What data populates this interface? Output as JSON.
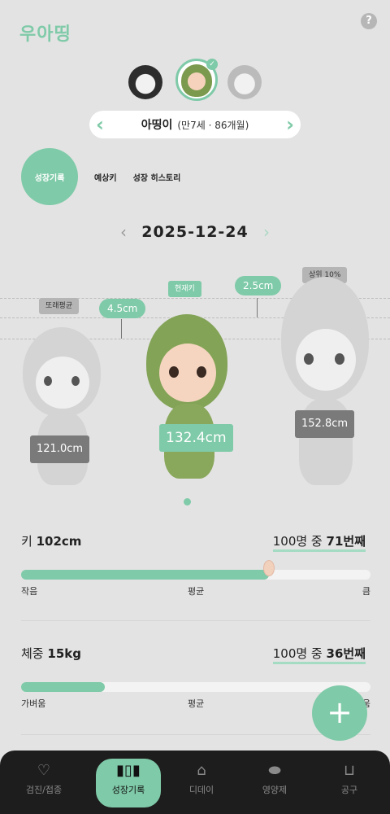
{
  "app": {
    "logo": "우아띵",
    "help_icon": "?"
  },
  "profile": {
    "name": "아띵이",
    "age": "(만7세 · 86개월)"
  },
  "tabs": {
    "growth_record": "성장기록",
    "predicted_height": "예상키",
    "growth_history": "성장 히스토리"
  },
  "date": "2025-12-24",
  "figures": {
    "peer_avg_label": "또래평균",
    "peer_avg_value": "121.0cm",
    "current_label": "현재키",
    "current_value": "132.4cm",
    "top_label": "상위 10%",
    "top_value": "152.8cm",
    "diff_peer": "4.5cm",
    "diff_top": "2.5cm"
  },
  "height": {
    "label": "키",
    "value": "102cm",
    "rank_prefix": "100명 중",
    "rank": "71번째",
    "percent": 71,
    "scale_low": "작음",
    "scale_mid": "평균",
    "scale_high": "큼"
  },
  "weight": {
    "label": "체중",
    "value": "15kg",
    "rank_prefix": "100명 중",
    "rank": "36번째",
    "percent": 24,
    "scale_low": "가벼움",
    "scale_mid": "평균",
    "scale_high": "무거움"
  },
  "nav": [
    {
      "label": "검진/접종",
      "icon": "heartbeat-icon"
    },
    {
      "label": "성장기록",
      "icon": "bar-chart-icon"
    },
    {
      "label": "디데이",
      "icon": "house-icon"
    },
    {
      "label": "영양제",
      "icon": "pill-icon"
    },
    {
      "label": "공구",
      "icon": "shopping-bag-icon"
    }
  ],
  "colors": {
    "accent": "#7fcaa8",
    "background": "#e3e3e3",
    "nav": "#1d1d1d"
  }
}
